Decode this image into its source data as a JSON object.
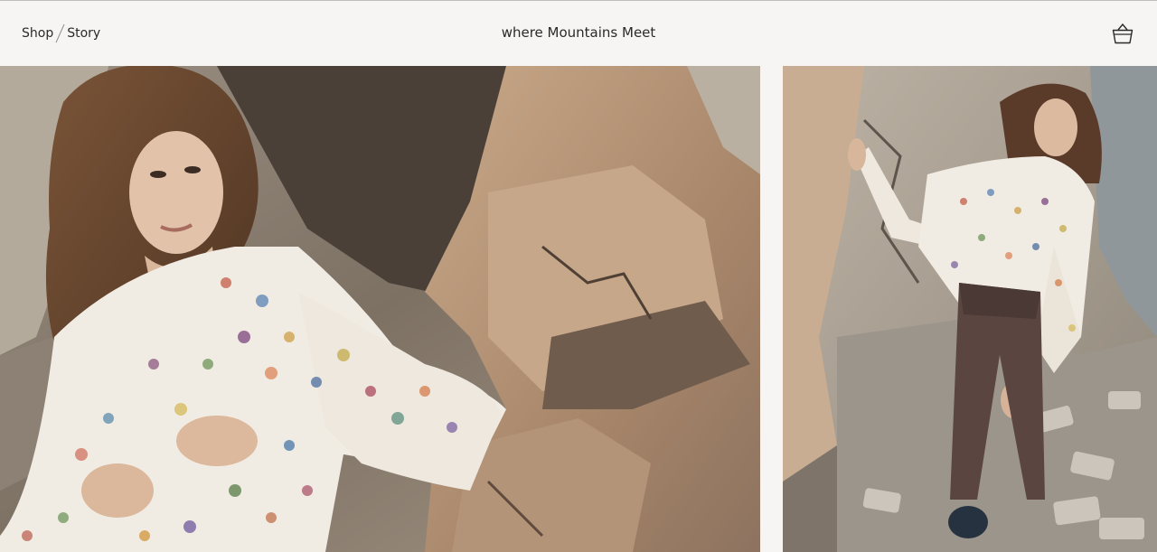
{
  "header": {
    "nav": {
      "shop_label": "Shop",
      "story_label": "Story"
    },
    "brand": "where Mountains Meet"
  },
  "icons": {
    "cart": "shopping-basket-icon"
  },
  "colors": {
    "header_bg": "#f6f5f3",
    "text": "#2a2a2a",
    "rock": "#a69784",
    "blouse": "#f2ede4",
    "pants": "#5a4540",
    "hair": "#6b4a33"
  }
}
